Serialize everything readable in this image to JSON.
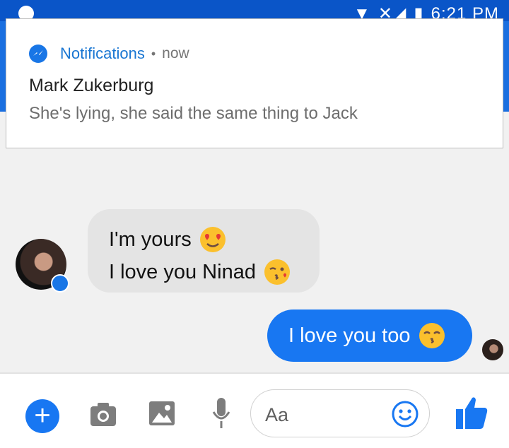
{
  "status_bar": {
    "time": "6:21 PM"
  },
  "notification": {
    "app_icon": "messenger-icon",
    "app_name": "Notifications",
    "separator": "•",
    "time": "now",
    "sender": "Mark Zukerburg",
    "message": "She's lying, she said the same thing to Jack"
  },
  "conversation": {
    "incoming": {
      "lines": [
        {
          "text": "I'm yours",
          "emoji": "heart-eyes-emoji"
        },
        {
          "text": "I love you Ninad",
          "emoji": "kissing-heart-emoji"
        }
      ]
    },
    "outgoing": {
      "text": "I love you too",
      "emoji": "kissing-smiling-eyes-emoji"
    }
  },
  "composer": {
    "buttons": [
      "plus-icon",
      "camera-icon",
      "image-icon",
      "microphone-icon",
      "smiley-icon",
      "thumbs-up-icon"
    ],
    "placeholder": "Aa",
    "plus_label": "+"
  },
  "colors": {
    "messenger_blue": "#1877f2",
    "incoming_bubble": "#e4e4e4",
    "header_blue": "#1a6fe0"
  }
}
